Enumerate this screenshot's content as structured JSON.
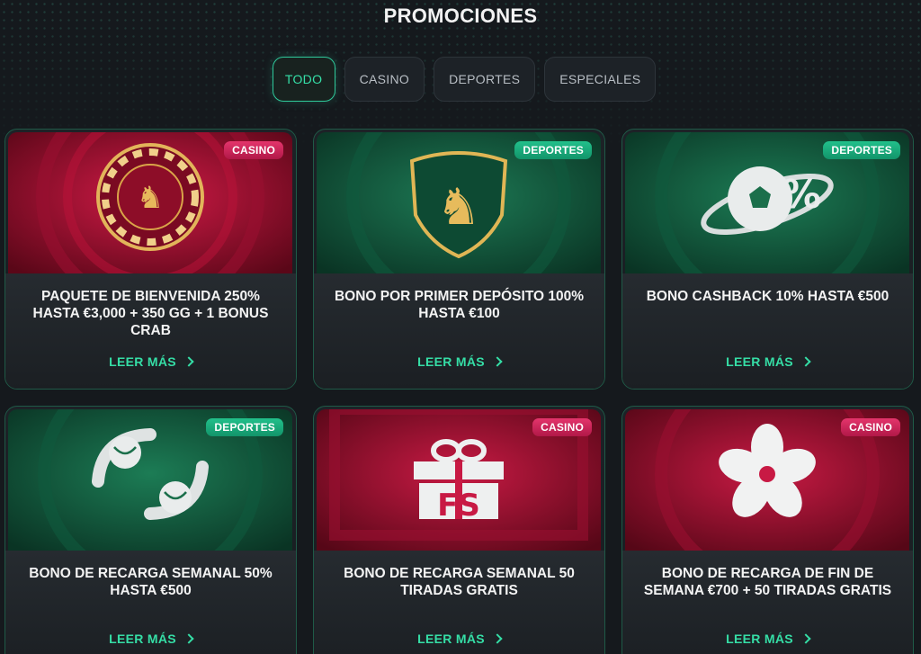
{
  "page": {
    "title": "PROMOCIONES"
  },
  "tabs": [
    {
      "label": "TODO",
      "active": true
    },
    {
      "label": "CASINO",
      "active": false
    },
    {
      "label": "DEPORTES",
      "active": false
    },
    {
      "label": "ESPECIALES",
      "active": false
    }
  ],
  "colors": {
    "accent": "#35dea6",
    "casino_badge": "#d8265d",
    "deportes_badge": "#1aae7c",
    "background": "#15191d"
  },
  "promos": [
    {
      "badge": "CASINO",
      "title": "PAQUETE DE BIENVENIDA 250% HASTA €3,000 + 350 GG + 1 BONUS CRAB",
      "cta": "LEER MÁS",
      "icon": "casino-chip-lion-icon"
    },
    {
      "badge": "DEPORTES",
      "title": "BONO POR PRIMER DEPÓSITO 100% HASTA €100",
      "cta": "LEER MÁS",
      "icon": "shield-lion-icon"
    },
    {
      "badge": "DEPORTES",
      "title": "BONO CASHBACK 10% HASTA €500",
      "cta": "LEER MÁS",
      "icon": "soccer-ball-percent-icon"
    },
    {
      "badge": "DEPORTES",
      "title": "BONO DE RECARGA SEMANAL 50% HASTA €500",
      "cta": "LEER MÁS",
      "icon": "balls-swirl-icon"
    },
    {
      "badge": "CASINO",
      "title": "BONO DE RECARGA SEMANAL 50 TIRADAS GRATIS",
      "cta": "LEER MÁS",
      "icon": "gift-fs-icon"
    },
    {
      "badge": "CASINO",
      "title": "BONO DE RECARGA DE FIN DE SEMANA €700 + 50 TIRADAS GRATIS",
      "cta": "LEER MÁS",
      "icon": "flower-icon"
    }
  ]
}
